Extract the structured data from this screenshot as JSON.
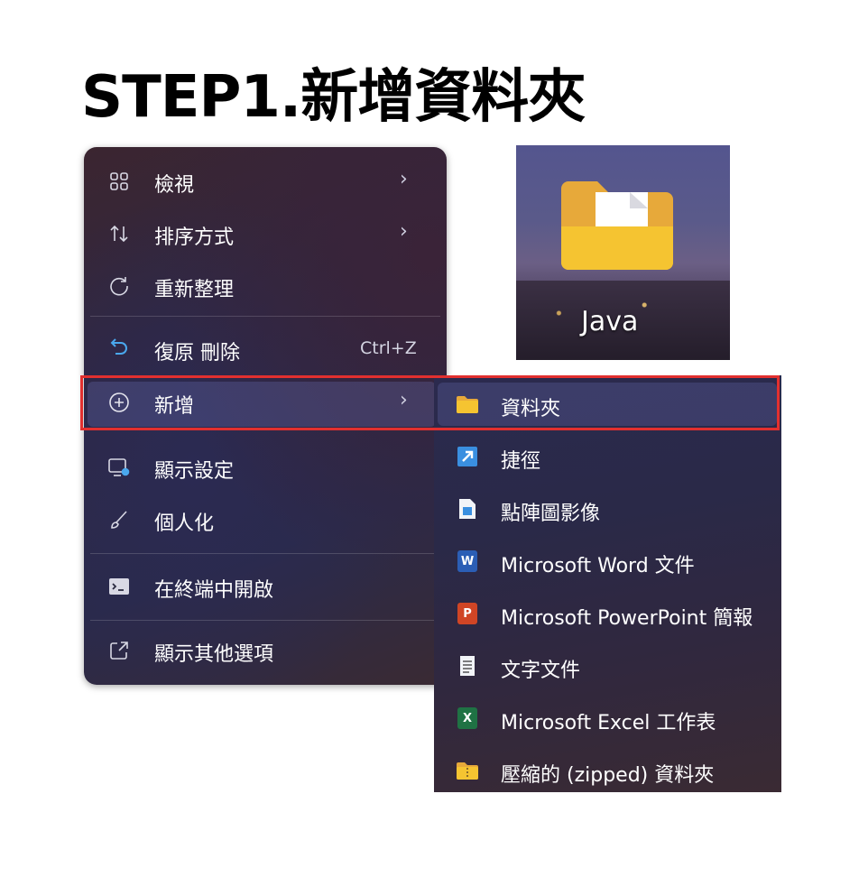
{
  "title": "STEP1.新增資料夾",
  "context_menu": {
    "items": [
      {
        "label": "檢視",
        "icon": "grid-icon",
        "has_submenu": true
      },
      {
        "label": "排序方式",
        "icon": "sort-icon",
        "has_submenu": true
      },
      {
        "label": "重新整理",
        "icon": "refresh-icon",
        "has_submenu": false
      },
      {
        "label": "復原 刪除",
        "icon": "undo-icon",
        "shortcut": "Ctrl+Z"
      },
      {
        "label": "新增",
        "icon": "add-circle-icon",
        "has_submenu": true,
        "highlighted": true
      },
      {
        "label": "顯示設定",
        "icon": "display-settings-icon"
      },
      {
        "label": "個人化",
        "icon": "brush-icon"
      },
      {
        "label": "在終端中開啟",
        "icon": "terminal-icon"
      },
      {
        "label": "顯示其他選項",
        "icon": "external-link-icon"
      }
    ],
    "submenu_arrow": "›"
  },
  "new_submenu": {
    "items": [
      {
        "label": "資料夾",
        "icon": "folder-icon",
        "highlighted": true
      },
      {
        "label": "捷徑",
        "icon": "shortcut-icon"
      },
      {
        "label": "點陣圖影像",
        "icon": "bitmap-icon"
      },
      {
        "label": "Microsoft Word 文件",
        "icon": "word-icon"
      },
      {
        "label": "Microsoft PowerPoint 簡報",
        "icon": "powerpoint-icon"
      },
      {
        "label": "文字文件",
        "icon": "text-document-icon"
      },
      {
        "label": "Microsoft Excel 工作表",
        "icon": "excel-icon"
      },
      {
        "label": "壓縮的 (zipped) 資料夾",
        "icon": "zip-folder-icon"
      }
    ]
  },
  "desktop_icon": {
    "label": "Java",
    "icon": "folder-icon"
  },
  "colors": {
    "highlight_border": "#e2302f",
    "folder": "#f5c431",
    "word": "#2b5eb5",
    "powerpoint": "#d04525",
    "excel": "#1f7244",
    "shortcut": "#3a8fe0"
  }
}
